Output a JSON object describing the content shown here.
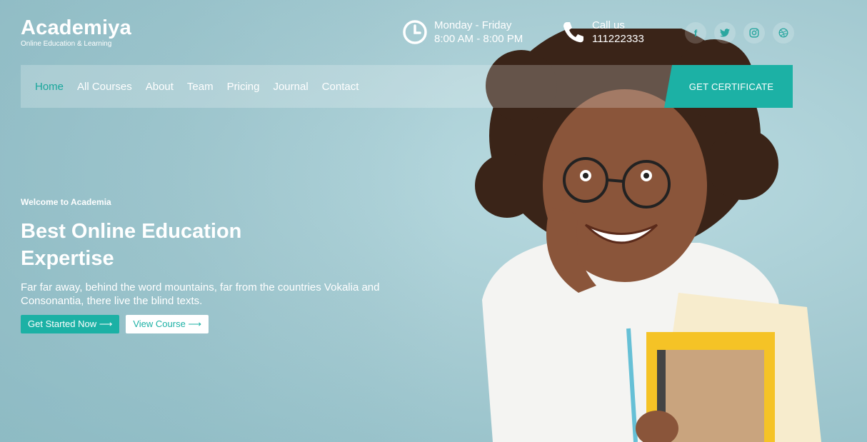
{
  "brand": {
    "name": "Academiya",
    "tagline": "Online Education & Learning"
  },
  "top_info": {
    "hours_line1": "Monday - Friday",
    "hours_line2": "8:00 AM - 8:00 PM",
    "call_line1": "Call us",
    "call_line2": "111222333"
  },
  "social": [
    "facebook-icon",
    "twitter-icon",
    "instagram-icon",
    "dribbble-icon"
  ],
  "nav": {
    "items": [
      "Home",
      "All Courses",
      "About",
      "Team",
      "Pricing",
      "Journal",
      "Contact"
    ],
    "active": "Home",
    "cta": "GET CERTIFICATE"
  },
  "hero": {
    "welcome": "Welcome to Academia",
    "title": "Best Online Education Expertise",
    "text": "Far far away, behind the word mountains, far from the countries Vokalia and Consonantia, there live the blind texts.",
    "primary_button": "Get Started Now ⟶",
    "secondary_button": "View Course ⟶"
  },
  "colors": {
    "accent": "#1cb1a5",
    "background": "#a9cfd6"
  }
}
